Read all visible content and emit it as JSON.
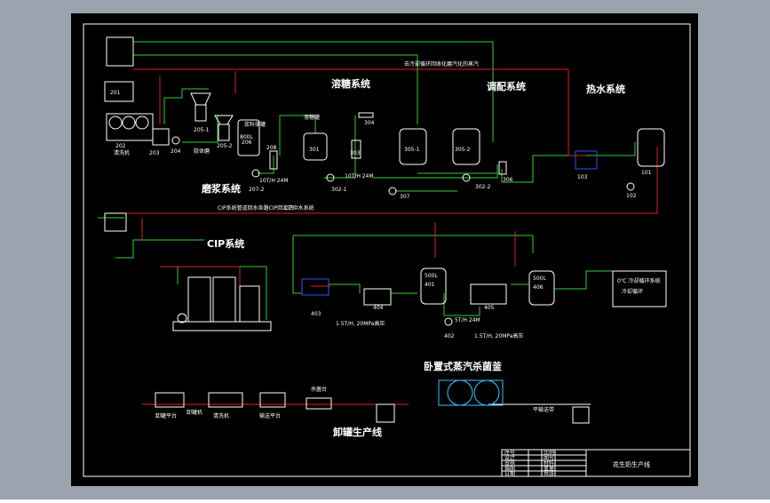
{
  "colors": {
    "window_bg": "#9aa3ae",
    "canvas_bg": "#000000",
    "frame": "#ffffff",
    "pipe_green": "#2fd12f",
    "pipe_red": "#e02020",
    "text": "#ffffff",
    "accent_cyan": "#33c6ff",
    "accent_blue": "#3050ff"
  },
  "sections": {
    "grinding": "磨浆系统",
    "mixing": "溶糖系统",
    "blending": "调配系统",
    "hot_water": "热水系统",
    "cip": "CIP系统",
    "retort": "卧置式蒸汽杀菌釜",
    "can_line": "卸罐生产线"
  },
  "notes": {
    "top_label": "去冷却循环回收化磨汽化的蒸汽",
    "cip_return": "CIP系统管道回水各路CIP回流口",
    "cip_supply": "CIP供水系统"
  },
  "equipment": {
    "e201": "201",
    "e202": "202",
    "e202_name": "清洗机",
    "e203": "203",
    "e204": "204",
    "e205_1": "205-1",
    "e205_2": "205-2",
    "e205_name": "胶体磨",
    "e206": "206",
    "e206_cap": "800L",
    "e206_name": "浆料储罐",
    "e207_2": "207-2",
    "e208": "208",
    "e301": "301",
    "e301_name": "溶糖罐",
    "e302_1": "302-1",
    "e303": "303",
    "e304": "304",
    "e305_1": "305-1",
    "e305_2": "305-2",
    "e306": "306",
    "e307": "307",
    "e302_2": "302-2",
    "e101": "101",
    "e102": "102",
    "e103": "103",
    "e401": "401",
    "e401_cap": "500L",
    "e402": "402",
    "e403": "403",
    "e404": "404",
    "e405": "405",
    "e406": "406",
    "e406_cap": "500L",
    "pump_flow_a": "10T/H 24M",
    "pump_flow_b": "10T/H 24M",
    "pump_flow_c": "5T/H 24M",
    "flow_note_1": "1.5T/H, 20MPa高压",
    "flow_note_2": "1.5T/H, 20MPa高压",
    "cooling_box": "0℃ 冷却循环系统",
    "cooling_box_2": "冷却循环"
  },
  "can_line": {
    "s1": "卸罐平台",
    "s2": "卸罐机",
    "s3": "清洗机",
    "s4": "输送平台",
    "s5": "杀菌台",
    "s6": "平输送带"
  },
  "title_block": {
    "r1": [
      "序号",
      "比例"
    ],
    "r2": [
      "设计",
      "图号"
    ],
    "r3": [
      "审核",
      "材料"
    ],
    "r4": [
      "描图",
      "重量"
    ],
    "r5": [
      "日期",
      "共张"
    ],
    "title": "花生奶生产线"
  }
}
